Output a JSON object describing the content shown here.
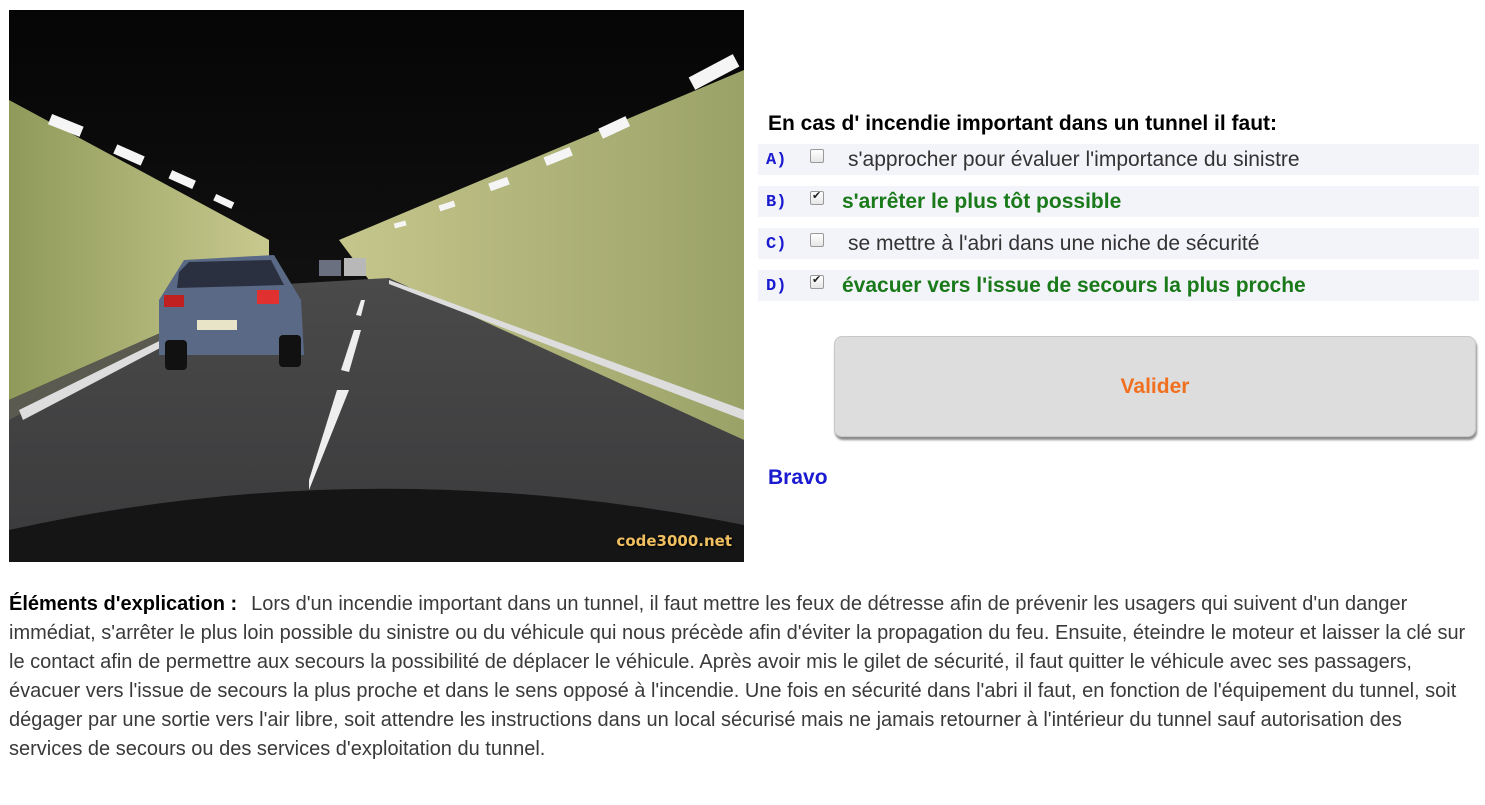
{
  "image": {
    "watermark": "code3000.net"
  },
  "question": {
    "text": "En cas d' incendie important dans un tunnel il faut:"
  },
  "answers": [
    {
      "letter": "A)",
      "text": "s'approcher pour évaluer l'importance du sinistre",
      "checked": false,
      "correct": false
    },
    {
      "letter": "B)",
      "text": "s'arrêter le plus tôt possible",
      "checked": true,
      "correct": true
    },
    {
      "letter": "C)",
      "text": "se mettre à l'abri dans une niche de sécurité",
      "checked": false,
      "correct": false
    },
    {
      "letter": "D)",
      "text": "évacuer vers l'issue de secours la plus proche",
      "checked": true,
      "correct": true
    }
  ],
  "validate_button": {
    "label": "Valider"
  },
  "feedback": {
    "text": "Bravo"
  },
  "explanation": {
    "heading": "Éléments d'explication :",
    "body": "Lors d'un incendie important dans un tunnel, il faut mettre les feux de détresse afin de prévenir les usagers qui suivent d'un danger immédiat, s'arrêter le plus loin possible du sinistre ou du véhicule qui nous précède afin d'éviter la propagation du feu. Ensuite, éteindre le moteur et laisser la clé sur le contact afin de permettre aux secours la possibilité de déplacer le véhicule. Après avoir mis le gilet de sécurité, il faut quitter le véhicule avec ses passagers, évacuer vers l'issue de secours la plus proche et dans le sens opposé à l'incendie. Une fois en sécurité dans l'abri il faut, en fonction de l'équipement du tunnel, soit dégager par une sortie vers l'air libre, soit attendre les instructions dans un local sécurisé mais ne jamais retourner à l'intérieur du tunnel sauf autorisation des services de secours ou des services d'exploitation du tunnel."
  },
  "colors": {
    "letter": "#1a1ad0",
    "correct": "#1a7a1a",
    "button_text": "#f07020",
    "feedback": "#1a1ad0"
  }
}
